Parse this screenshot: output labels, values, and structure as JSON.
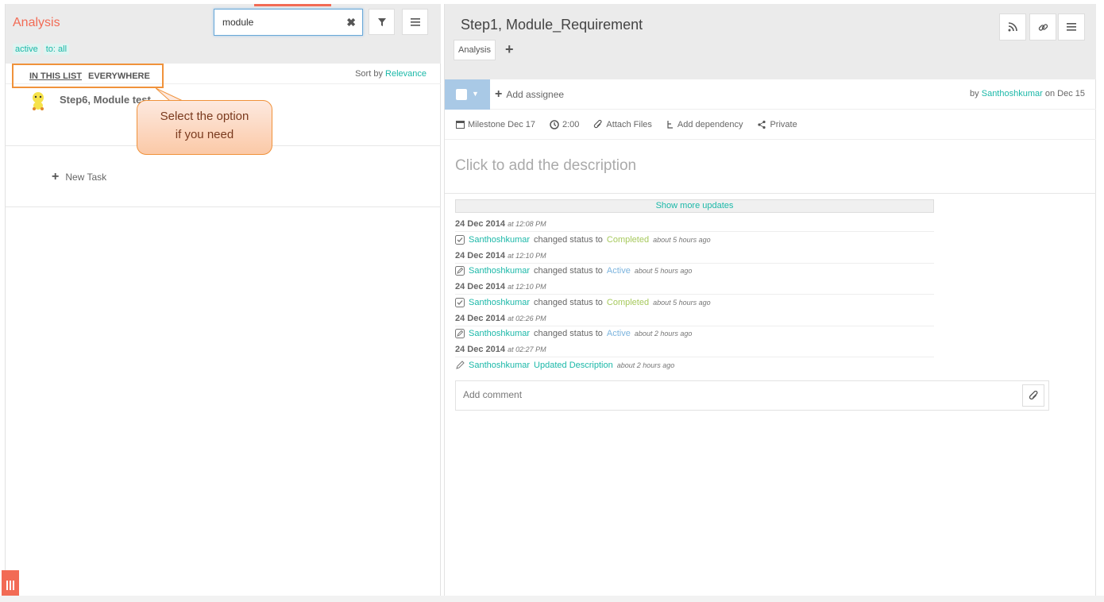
{
  "left_panel": {
    "list_title": "Analysis",
    "filters": [
      "active",
      "to: all"
    ],
    "search": {
      "value": "module",
      "placeholder": ""
    },
    "scope": {
      "in_this_list": "IN THIS LIST",
      "everywhere": "EVERYWHERE"
    },
    "sort": {
      "label": "Sort by",
      "value": "Relevance"
    },
    "tasks": [
      {
        "name": "Step6, Module test"
      }
    ],
    "new_task_label": "New Task",
    "callout": {
      "line1": "Select the option",
      "line2": "if you need"
    }
  },
  "right_panel": {
    "task_title": "Step1, Module_Requirement",
    "tag": "Analysis",
    "add_assignee": "Add assignee",
    "byline": {
      "by": "by",
      "user": "Santhoshkumar",
      "on": "on Dec 15"
    },
    "meta": {
      "milestone": "Milestone Dec 17",
      "time": "2:00",
      "attach": "Attach Files",
      "dependency": "Add dependency",
      "privacy": "Private"
    },
    "description_placeholder": "Click to add the description",
    "show_more": "Show more updates",
    "updates": [
      {
        "date": "24 Dec 2014",
        "time": "at 12:08 PM",
        "user": "Santhoshkumar",
        "action": "changed status to",
        "status": "Completed",
        "ago": "about 5 hours ago"
      },
      {
        "date": "24 Dec 2014",
        "time": "at 12:10 PM",
        "user": "Santhoshkumar",
        "action": "changed status to",
        "status": "Active",
        "ago": "about 5 hours ago"
      },
      {
        "date": "24 Dec 2014",
        "time": "at 12:10 PM",
        "user": "Santhoshkumar",
        "action": "changed status to",
        "status": "Completed",
        "ago": "about 5 hours ago"
      },
      {
        "date": "24 Dec 2014",
        "time": "at 02:26 PM",
        "user": "Santhoshkumar",
        "action": "changed status to",
        "status": "Active",
        "ago": "about 2 hours ago"
      },
      {
        "date": "24 Dec 2014",
        "time": "at 02:27 PM",
        "user": "Santhoshkumar",
        "action": "Updated Description",
        "status": "",
        "ago": "about 2 hours ago"
      }
    ],
    "comment_placeholder": "Add comment"
  },
  "colors": {
    "accent": "#f26b55",
    "link": "#1bb8a8",
    "completed": "#a6c95c",
    "active": "#7cb4de",
    "highlight": "#f0923b"
  }
}
